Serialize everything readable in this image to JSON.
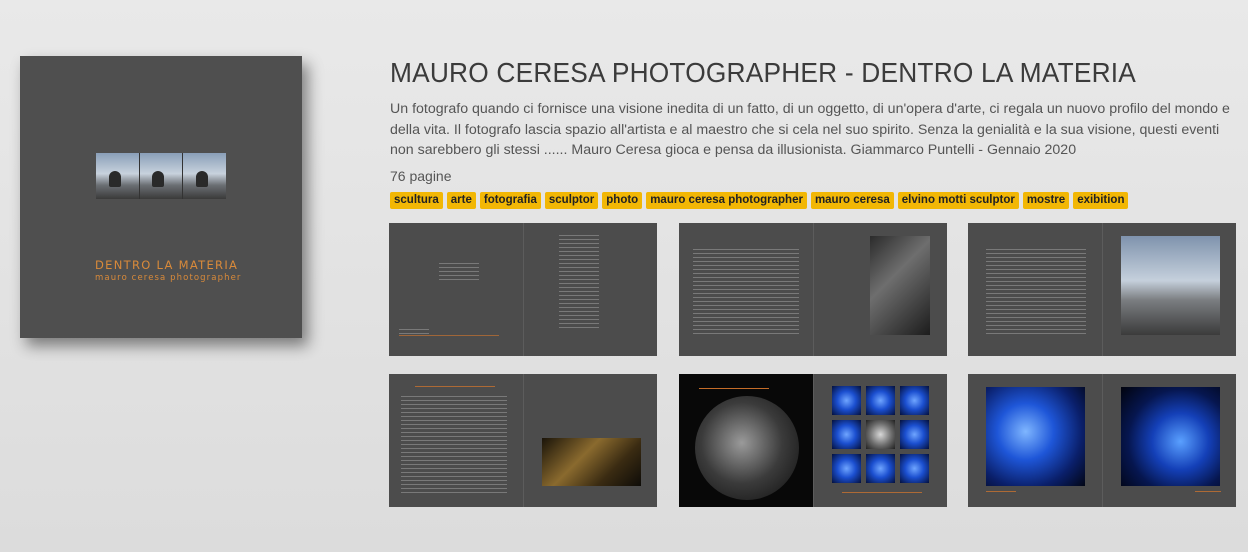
{
  "cover": {
    "title": "DENTRO LA MATERIA",
    "subtitle": "mauro ceresa photographer"
  },
  "book": {
    "title": "MAURO CERESA PHOTOGRAPHER - DENTRO LA MATERIA",
    "description": "Un fotografo quando ci fornisce una visione inedita di un fatto, di un oggetto, di un'opera d'arte, ci regala un nuovo profilo del mondo e della vita. Il fotografo lascia spazio all'artista e al maestro che si cela nel suo spirito. Senza la genialità e la sua visione, questi eventi non sarebbero gli stessi ...... Mauro Ceresa gioca e pensa da illusionista. Giammarco Puntelli - Gennaio 2020",
    "pages": "76 pagine",
    "tags": [
      "scultura",
      "arte",
      "fotografia",
      "sculptor",
      "photo",
      "mauro ceresa photographer",
      "mauro ceresa",
      "elvino motti sculptor",
      "mostre",
      "exibition"
    ]
  },
  "colors": {
    "tag_bg": "#f2b705",
    "cover_accent": "#d98a3a",
    "cover_bg": "#4f4f4f"
  }
}
